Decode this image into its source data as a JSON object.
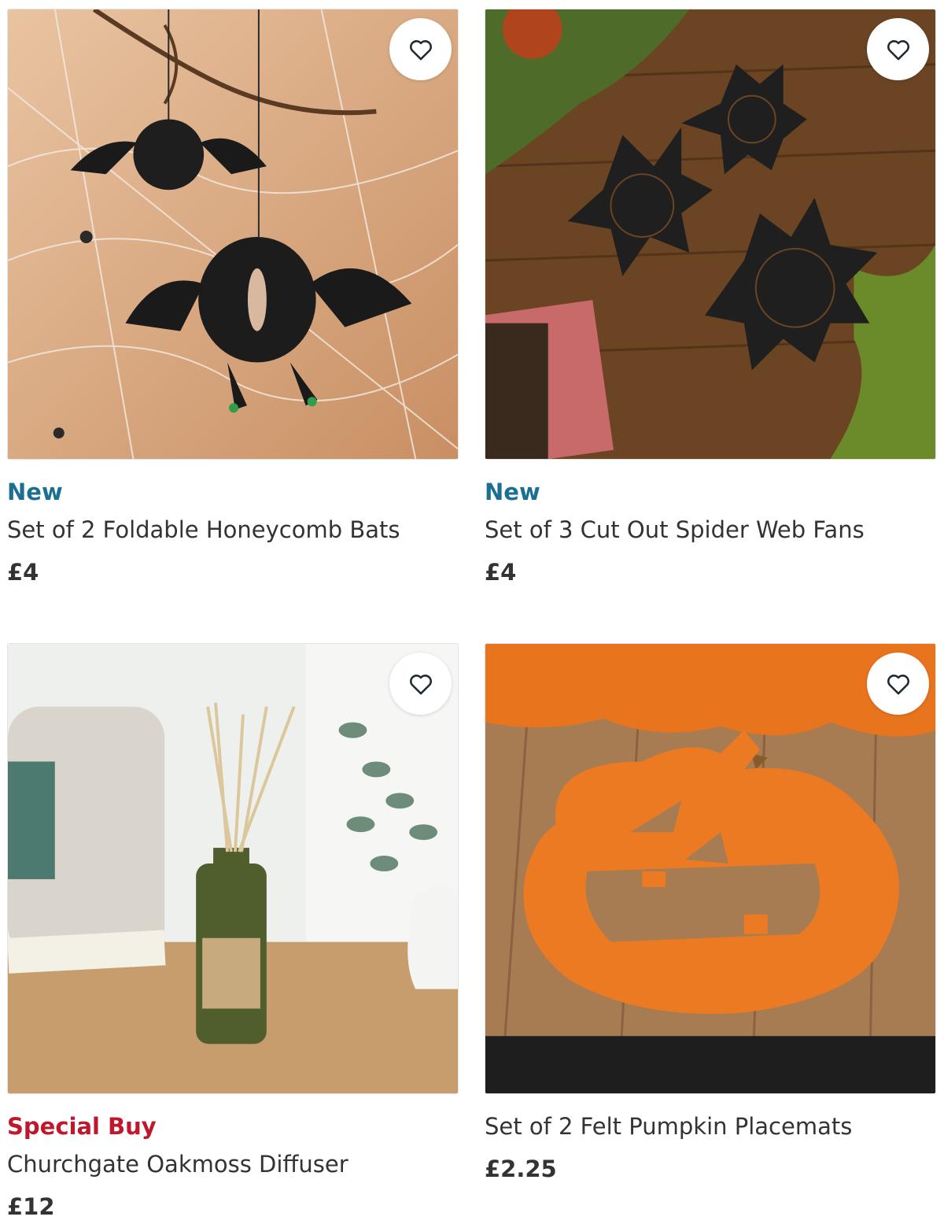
{
  "products": [
    {
      "badge": "New",
      "name": "Set of 2 Foldable Honeycomb Bats",
      "price": "£4",
      "favourite_icon": "heart-outline-icon"
    },
    {
      "badge": "New",
      "name": "Set of 3 Cut Out Spider Web Fans",
      "price": "£4",
      "favourite_icon": "heart-outline-icon"
    },
    {
      "badge": "Special Buy",
      "name": "Churchgate Oakmoss Diffuser",
      "price": "£12",
      "favourite_icon": "heart-outline-icon"
    },
    {
      "badge": "",
      "name": "Set of 2 Felt Pumpkin Placemats",
      "price": "£2.25",
      "favourite_icon": "heart-outline-icon"
    }
  ],
  "colors": {
    "badge_new": "#1a6f93",
    "badge_special": "#c0172c",
    "text": "#333333"
  }
}
